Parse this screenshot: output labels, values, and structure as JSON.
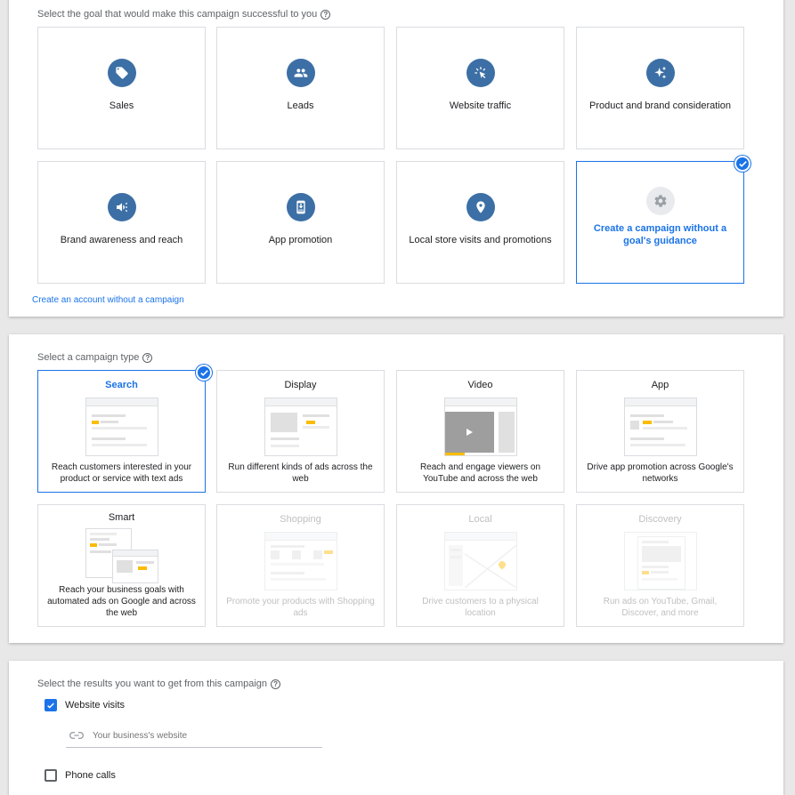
{
  "goals": {
    "title": "Select the goal that would make this campaign successful to you",
    "items": [
      {
        "label": "Sales",
        "icon": "tag-icon"
      },
      {
        "label": "Leads",
        "icon": "people-icon"
      },
      {
        "label": "Website traffic",
        "icon": "cursor-click-icon"
      },
      {
        "label": "Product and brand consideration",
        "icon": "sparkle-icon"
      },
      {
        "label": "Brand awareness and reach",
        "icon": "megaphone-icon"
      },
      {
        "label": "App promotion",
        "icon": "phone-download-icon"
      },
      {
        "label": "Local store visits and promotions",
        "icon": "location-pin-icon"
      },
      {
        "label": "Create a campaign without a goal's guidance",
        "icon": "gear-icon",
        "selected": true
      }
    ],
    "account_link": "Create an account without a campaign"
  },
  "campaign_types": {
    "title": "Select a campaign type",
    "items": [
      {
        "name": "Search",
        "desc": "Reach customers interested in your product or service with text ads",
        "selected": true
      },
      {
        "name": "Display",
        "desc": "Run different kinds of ads across the web"
      },
      {
        "name": "Video",
        "desc": "Reach and engage viewers on YouTube and across the web"
      },
      {
        "name": "App",
        "desc": "Drive app promotion across Google's networks"
      },
      {
        "name": "Smart",
        "desc": "Reach your business goals with automated ads on Google and across the web"
      },
      {
        "name": "Shopping",
        "desc": "Promote your products with Shopping ads",
        "disabled": true
      },
      {
        "name": "Local",
        "desc": "Drive customers to a physical location",
        "disabled": true
      },
      {
        "name": "Discovery",
        "desc": "Run ads on YouTube, Gmail, Discover, and more",
        "disabled": true
      }
    ]
  },
  "results": {
    "title": "Select the results you want to get from this campaign",
    "website_visits_label": "Website visits",
    "website_visits_checked": true,
    "website_placeholder": "Your business's website",
    "phone_calls_label": "Phone calls",
    "phone_calls_checked": false
  },
  "colors": {
    "accent": "#1a73e8",
    "goal_icon_bg": "#3c6fa5",
    "highlight": "#fbbc04"
  }
}
